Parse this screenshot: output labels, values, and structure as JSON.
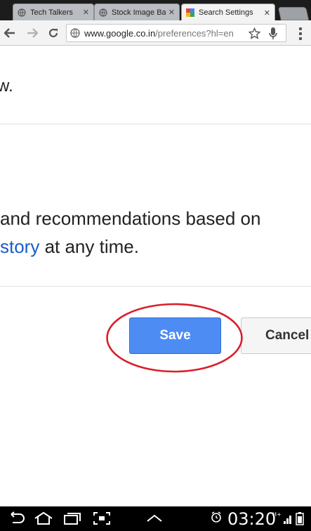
{
  "tabs": [
    {
      "title": "Tech Talkers",
      "favicon": "globe-icon",
      "active": false
    },
    {
      "title": "Stock Image Ba",
      "favicon": "globe-icon",
      "active": false
    },
    {
      "title": "Search Settings",
      "favicon": "google-favicon",
      "active": true
    }
  ],
  "toolbar": {
    "url_domain": "www.google.co.in",
    "url_path": "/preferences?hl=en"
  },
  "content": {
    "fragment_top": "w.",
    "line1": "and recommendations based on",
    "line2_link": "story",
    "line2_rest": " at any time."
  },
  "buttons": {
    "save": "Save",
    "cancel": "Cancel"
  },
  "statusbar": {
    "time": "03:20",
    "network": "H+"
  },
  "colors": {
    "save_button": "#4d8cf3",
    "link": "#1a5cc8",
    "highlight_ring": "#d8202a"
  }
}
